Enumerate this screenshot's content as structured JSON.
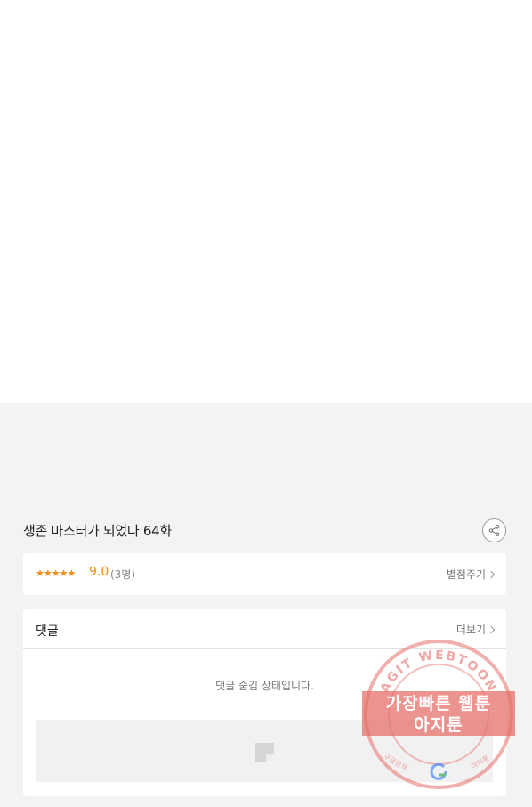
{
  "episode": {
    "title": "생존 마스터가 되었다 64화"
  },
  "rating": {
    "stars": "★★★★★",
    "score": "9.0",
    "count": "(3명)",
    "rate_label": "별점주기",
    "value": 9.0
  },
  "comments": {
    "title": "댓글",
    "more_label": "더보기",
    "hidden_message": "댓글 숨김 상태입니다."
  },
  "watermark": {
    "arc_text": "AGIT WEBTOON",
    "line1": "가장빠른 웹툰",
    "line2": "아지툰",
    "bottom_left": "구글검색",
    "bottom_right": "아지툰",
    "color": "#e6706a"
  },
  "colors": {
    "accent": "#f28c13",
    "page_bg": "#f3f3f3",
    "card_bg": "#ffffff"
  },
  "icons": {
    "share": "share-icon",
    "chevron": "chevron-right-icon",
    "ad": "ad-placeholder-icon"
  }
}
